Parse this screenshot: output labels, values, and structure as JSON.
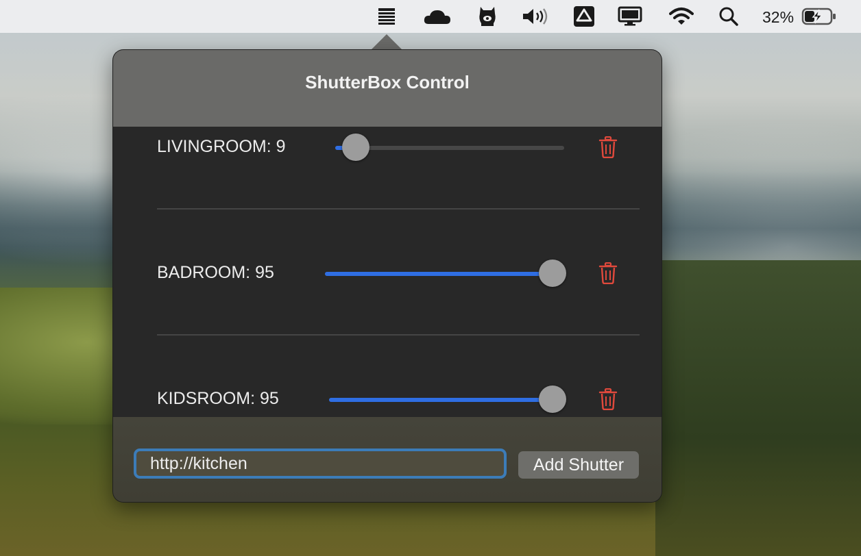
{
  "menubar": {
    "icons": [
      "shutterbox-icon",
      "cloud-icon",
      "alpaca-icon",
      "volume-icon",
      "drive-icon",
      "display-icon",
      "wifi-icon",
      "search-icon",
      "battery-icon"
    ],
    "battery_percent": "32%"
  },
  "popover": {
    "title": "ShutterBox Control",
    "shutters": [
      {
        "label": "LIVINGROOM: 9",
        "value": 9
      },
      {
        "label": "BADROOM: 95",
        "value": 95
      },
      {
        "label": "KIDSROOM: 95",
        "value": 95
      }
    ],
    "url_input": {
      "value": "http://kitchen"
    },
    "add_button": "Add Shutter"
  },
  "colors": {
    "accent": "#2f6ee3",
    "delete": "#e0493c",
    "focus_ring": "#3c7cb8"
  }
}
